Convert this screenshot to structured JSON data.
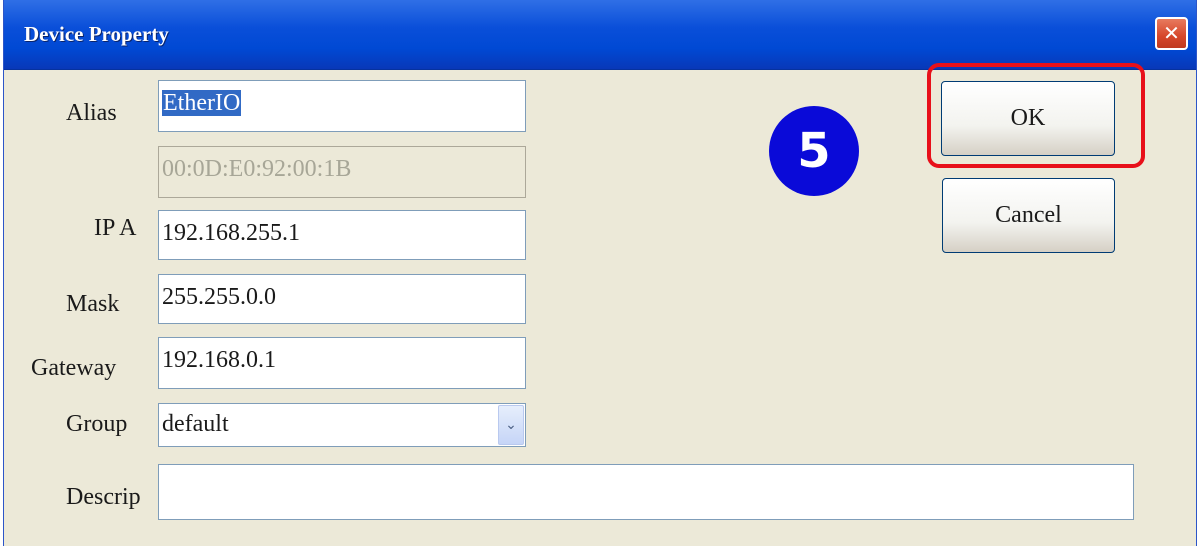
{
  "window": {
    "title": "Device Property",
    "close_symbol": "✕"
  },
  "labels": {
    "alias": "Alias",
    "ip": "IP A",
    "mask": "Mask",
    "gateway": "Gateway",
    "group": "Group",
    "description": "Descrip"
  },
  "fields": {
    "alias": "EtherIO",
    "mac": "00:0D:E0:92:00:1B",
    "ip": "192.168.255.1",
    "mask": "255.255.0.0",
    "gateway": "192.168.0.1",
    "group": "default",
    "description": ""
  },
  "buttons": {
    "ok": "OK",
    "cancel": "Cancel"
  },
  "annotation": {
    "step": "5"
  },
  "colors": {
    "titlebar": "#0a4fd9",
    "highlight": "#e8101a",
    "badge": "#0a0ad8",
    "window_bg": "#ece9d8"
  },
  "icons": {
    "close": "close-icon",
    "dropdown": "chevron-down-icon"
  }
}
